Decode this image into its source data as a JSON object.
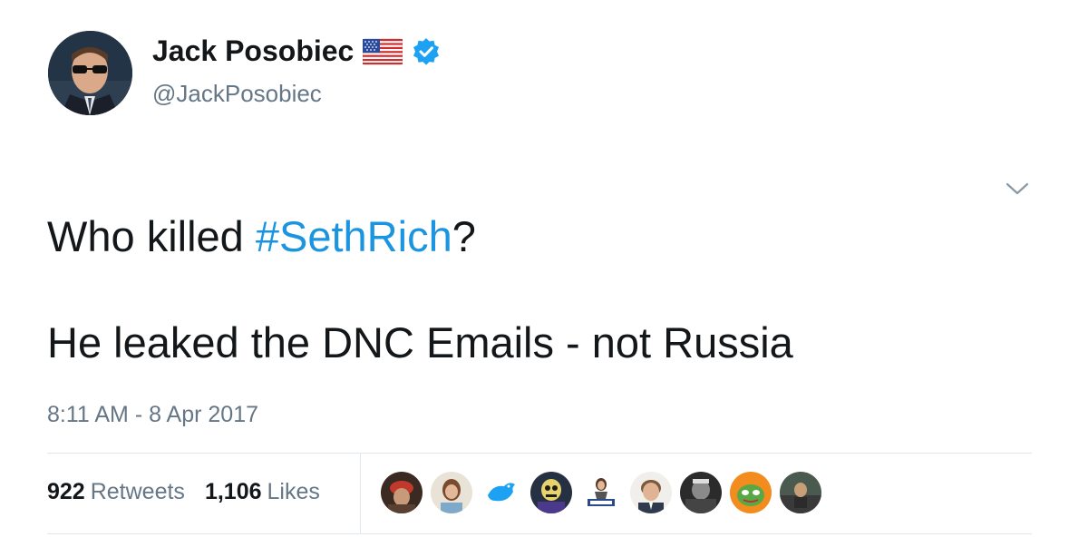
{
  "author": {
    "display_name": "Jack Posobiec",
    "handle": "@JackPosobiec",
    "avatar_icon": "profile-avatar",
    "flag_icon": "us-flag-emoji",
    "verified_icon": "verified-badge-icon"
  },
  "tweet": {
    "text_line1_prefix": "Who killed ",
    "hashtag": "#SethRich",
    "text_line1_suffix": "?",
    "text_line2": "He leaked the DNC Emails - not Russia",
    "timestamp": "8:11 AM - 8 Apr 2017"
  },
  "stats": {
    "retweets_count": "922",
    "retweets_label": "Retweets",
    "likes_count": "1,106",
    "likes_label": "Likes"
  },
  "likers": [
    "liker-avatar",
    "liker-avatar",
    "liker-avatar",
    "liker-avatar",
    "liker-avatar",
    "liker-avatar",
    "liker-avatar",
    "liker-avatar",
    "liker-avatar"
  ],
  "colors": {
    "link": "#1b95e0",
    "secondary_text": "#657786",
    "primary_text": "#14171a",
    "divider": "#e1e8ed",
    "verified": "#1da1f2"
  }
}
